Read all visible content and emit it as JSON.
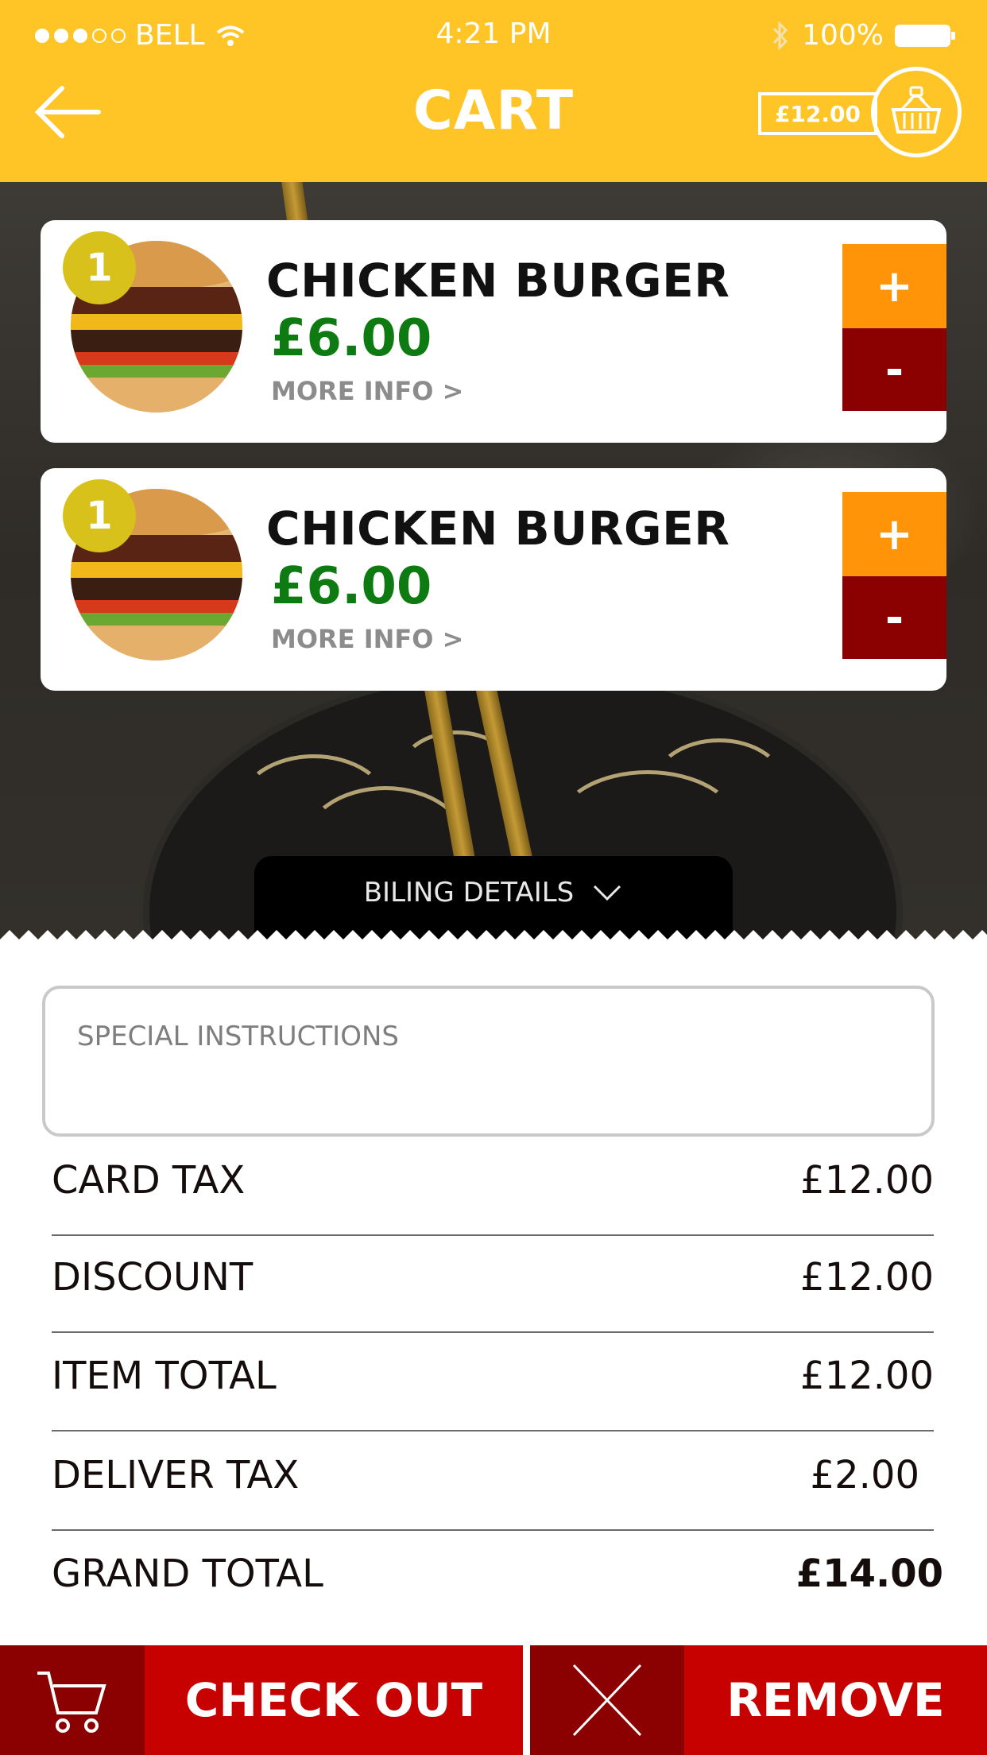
{
  "status_bar": {
    "carrier": "BELL",
    "time": "4:21 PM",
    "battery": "100%"
  },
  "header": {
    "title": "CART",
    "cart_total": "£12.00"
  },
  "items": [
    {
      "quantity": "1",
      "name": "CHICKEN BURGER",
      "price": "£6.00",
      "more_info": "MORE INFO >",
      "plus_label": "+",
      "minus_label": "-"
    },
    {
      "quantity": "1",
      "name": "CHICKEN BURGER",
      "price": "£6.00",
      "more_info": "MORE INFO >",
      "plus_label": "+",
      "minus_label": "-"
    }
  ],
  "billing_tab": {
    "label": "BILING DETAILS"
  },
  "special_instructions": {
    "placeholder": "SPECIAL INSTRUCTIONS"
  },
  "summary": {
    "card_tax": {
      "label": "CARD TAX",
      "value": "£12.00"
    },
    "discount": {
      "label": "DISCOUNT",
      "value": "£12.00"
    },
    "item_total": {
      "label": "ITEM TOTAL",
      "value": "£12.00"
    },
    "deliver_tax": {
      "label": "DELIVER TAX",
      "value": "£2.00"
    },
    "grand_total": {
      "label": "GRAND TOTAL",
      "value": "£14.00"
    }
  },
  "footer": {
    "checkout_label": "CHECK OUT",
    "remove_label": "REMOVE"
  },
  "colors": {
    "header_yellow": "#ffc526",
    "plus_orange": "#ff9408",
    "minus_dark_red": "#8b0000",
    "price_green": "#0e7a12",
    "badge_yellow": "#d8c11a",
    "footer_red": "#c70000",
    "footer_dark_red": "#8b0000"
  },
  "icons": {
    "back": "back-arrow-icon",
    "basket": "basket-icon",
    "billing_toggle": "chevron-down-icon",
    "checkout": "shopping-cart-icon",
    "remove": "close-x-icon",
    "wifi": "wifi-icon",
    "bluetooth": "bluetooth-icon",
    "battery": "battery-icon"
  }
}
